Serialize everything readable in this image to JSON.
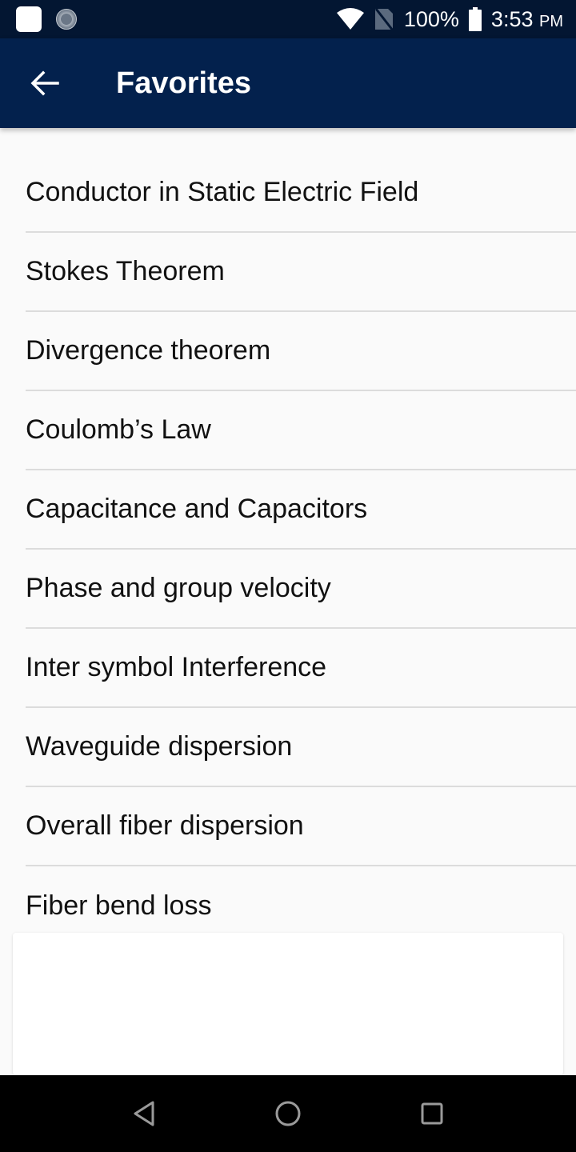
{
  "status_bar": {
    "battery_percent": "100%",
    "time": "3:53",
    "time_suffix": "PM",
    "icons": [
      "notification-square-icon",
      "clock-app-icon",
      "wifi-icon",
      "no-sim-icon",
      "battery-icon"
    ]
  },
  "app_bar": {
    "title": "Favorites",
    "back_icon": "arrow-left-icon"
  },
  "favorites": [
    {
      "label": "Conductor in Static Electric Field"
    },
    {
      "label": "Stokes Theorem"
    },
    {
      "label": "Divergence theorem"
    },
    {
      "label": "Coulomb’s Law"
    },
    {
      "label": "Capacitance and Capacitors"
    },
    {
      "label": "Phase and group velocity"
    },
    {
      "label": "Inter symbol Interference"
    },
    {
      "label": "Waveguide dispersion"
    },
    {
      "label": "Overall fiber dispersion"
    },
    {
      "label": "Fiber bend loss"
    }
  ],
  "nav_bar": {
    "back": "back-triangle-icon",
    "home": "home-circle-icon",
    "recents": "recents-square-icon"
  },
  "colors": {
    "status_bar_bg": "#031632",
    "app_bar_bg": "#03214d",
    "list_bg": "#fafafa",
    "divider": "#dcdcdc"
  }
}
